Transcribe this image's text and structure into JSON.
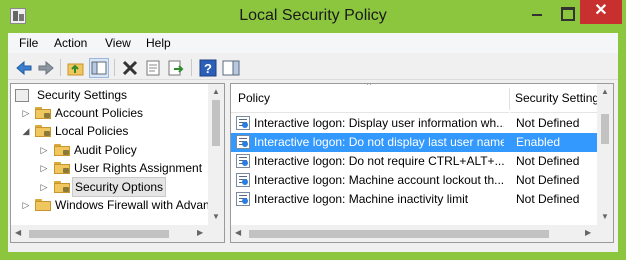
{
  "window": {
    "title": "Local Security Policy",
    "close_glyph": "✕"
  },
  "menubar": {
    "items": [
      "File",
      "Action",
      "View",
      "Help"
    ]
  },
  "toolbar": {
    "buttons": [
      "back-arrow-icon",
      "forward-arrow-icon",
      "up-folder-icon",
      "show-hide-console-tree-icon",
      "delete-icon",
      "properties-icon",
      "export-list-icon",
      "help-icon",
      "show-action-pane-icon"
    ]
  },
  "tree": {
    "items": [
      {
        "label": "Security Settings",
        "depth": 0,
        "expanded": true
      },
      {
        "label": "Account Policies",
        "depth": 1,
        "expanded": false
      },
      {
        "label": "Local Policies",
        "depth": 1,
        "expanded": true
      },
      {
        "label": "Audit Policy",
        "depth": 2,
        "expanded": false
      },
      {
        "label": "User Rights Assignment",
        "depth": 2,
        "expanded": false
      },
      {
        "label": "Security Options",
        "depth": 2,
        "expanded": false,
        "selected": true
      },
      {
        "label": "Windows Firewall with Advan",
        "depth": 1,
        "expanded": false
      }
    ]
  },
  "list": {
    "columns": [
      "Policy",
      "Security Setting"
    ],
    "sort_glyph": "^",
    "rows": [
      {
        "policy": "Interactive logon: Display user information wh...",
        "setting": "Not Defined",
        "selected": false
      },
      {
        "policy": "Interactive logon: Do not display last user name",
        "setting": "Enabled",
        "selected": true
      },
      {
        "policy": "Interactive logon: Do not require CTRL+ALT+...",
        "setting": "Not Defined",
        "selected": false
      },
      {
        "policy": "Interactive logon: Machine account lockout th...",
        "setting": "Not Defined",
        "selected": false
      },
      {
        "policy": "Interactive logon: Machine inactivity limit",
        "setting": "Not Defined",
        "selected": false
      }
    ]
  },
  "colors": {
    "titlebar": "#8cc63f",
    "close_button": "#c7302f",
    "selection": "#3399ff"
  }
}
